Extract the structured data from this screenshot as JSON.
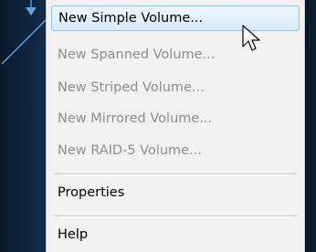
{
  "context_menu": {
    "items": [
      {
        "label": "New Simple Volume...",
        "enabled": true,
        "highlighted": true
      },
      {
        "label": "New Spanned Volume...",
        "enabled": false
      },
      {
        "label": "New Striped Volume...",
        "enabled": false
      },
      {
        "label": "New Mirrored Volume...",
        "enabled": false
      },
      {
        "label": "New RAID-5 Volume...",
        "enabled": false
      }
    ],
    "properties_label": "Properties",
    "help_label": "Help"
  },
  "colors": {
    "highlight_border": "#90c2ee",
    "highlight_fill": "#d7ebfb",
    "disabled_text": "#8e8e8e",
    "background": "#0d1f33",
    "callout_line": "#5fa3df"
  },
  "icons": {
    "pointer": "mouse-pointer-icon"
  }
}
